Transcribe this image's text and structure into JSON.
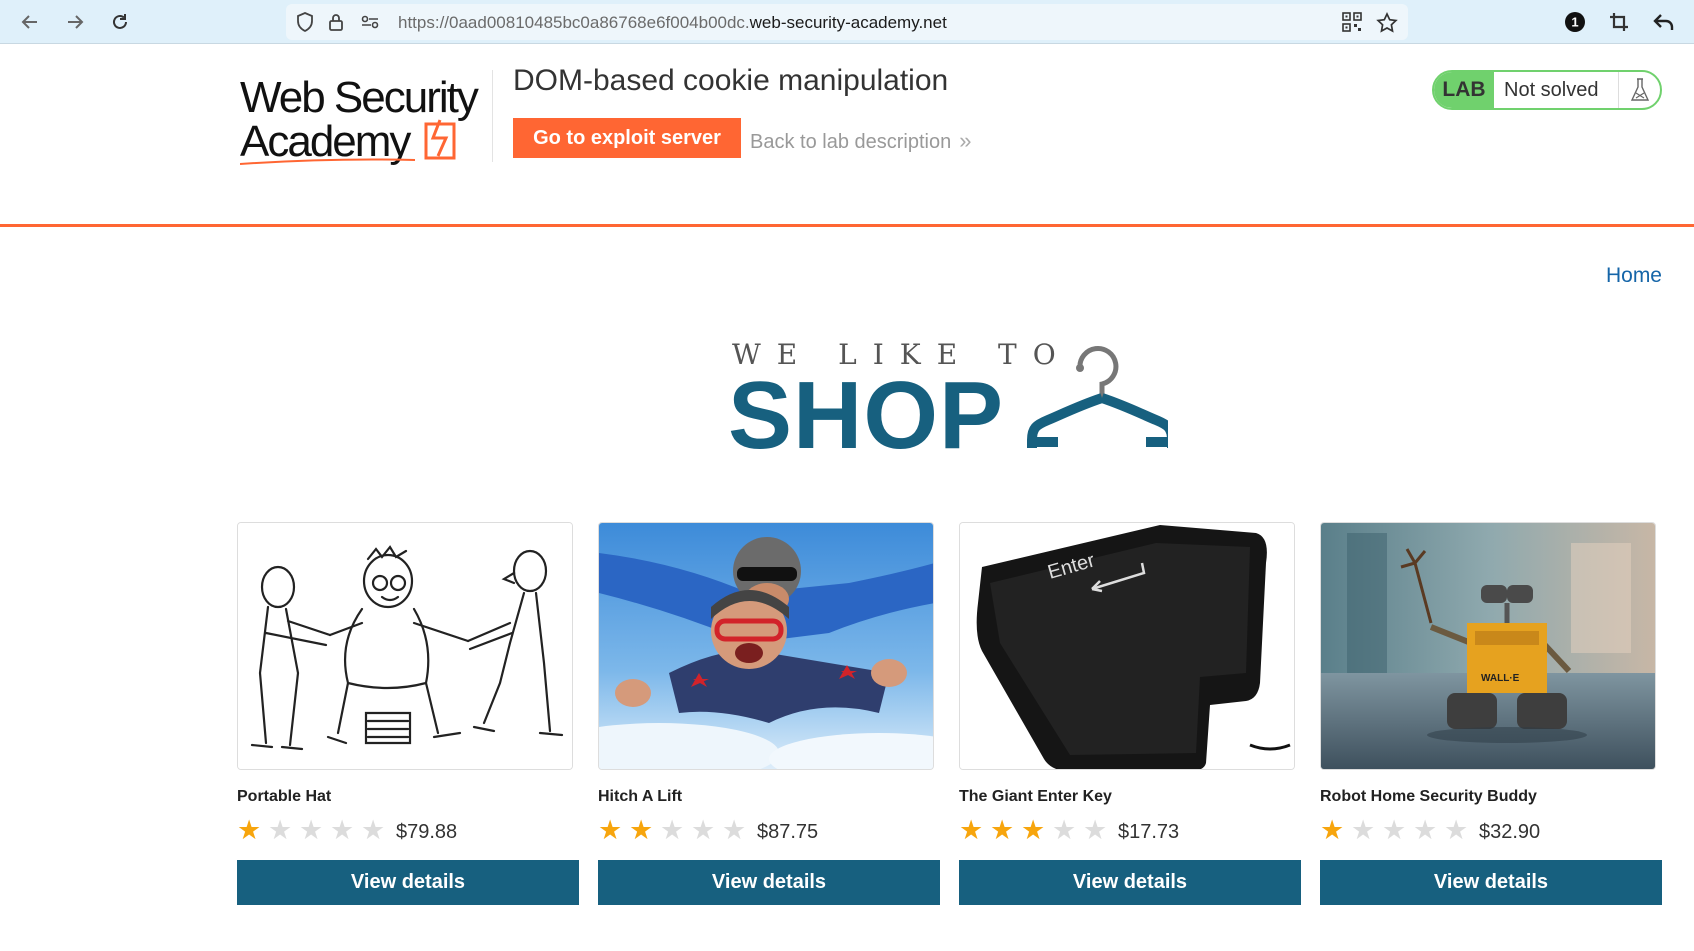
{
  "browser": {
    "url_prefix": "https://0aad00810485bc0a86768e6f004b00dc.",
    "url_domain": "web-security-academy.net",
    "badge_count": "1"
  },
  "lab": {
    "logo_text_line1": "Web Security",
    "logo_text_line2": "Academy",
    "title": "DOM-based cookie manipulation",
    "exploit_button": "Go to exploit server",
    "back_link": "Back to lab description",
    "badge": "LAB",
    "status": "Not solved",
    "accent_color": "#ff6633",
    "status_color": "#70d16d"
  },
  "shop": {
    "home_link": "Home",
    "banner_top": "WE LIKE TO",
    "banner_main": "SHOP",
    "brand_color": "#17607f"
  },
  "products": [
    {
      "name": "Portable Hat",
      "rating": 1,
      "max_rating": 5,
      "price": "$79.88",
      "button": "View details",
      "image": "cartoon-people-tug-of-war"
    },
    {
      "name": "Hitch A Lift",
      "rating": 2,
      "max_rating": 5,
      "price": "$87.75",
      "button": "View details",
      "image": "tandem-skydivers"
    },
    {
      "name": "The Giant Enter Key",
      "rating": 3,
      "max_rating": 5,
      "price": "$17.73",
      "button": "View details",
      "image": "giant-enter-key-cushion",
      "image_text": "Enter"
    },
    {
      "name": "Robot Home Security Buddy",
      "rating": 1,
      "max_rating": 5,
      "price": "$32.90",
      "button": "View details",
      "image": "wall-e-robot-toy",
      "image_text": "WALL·E"
    }
  ]
}
